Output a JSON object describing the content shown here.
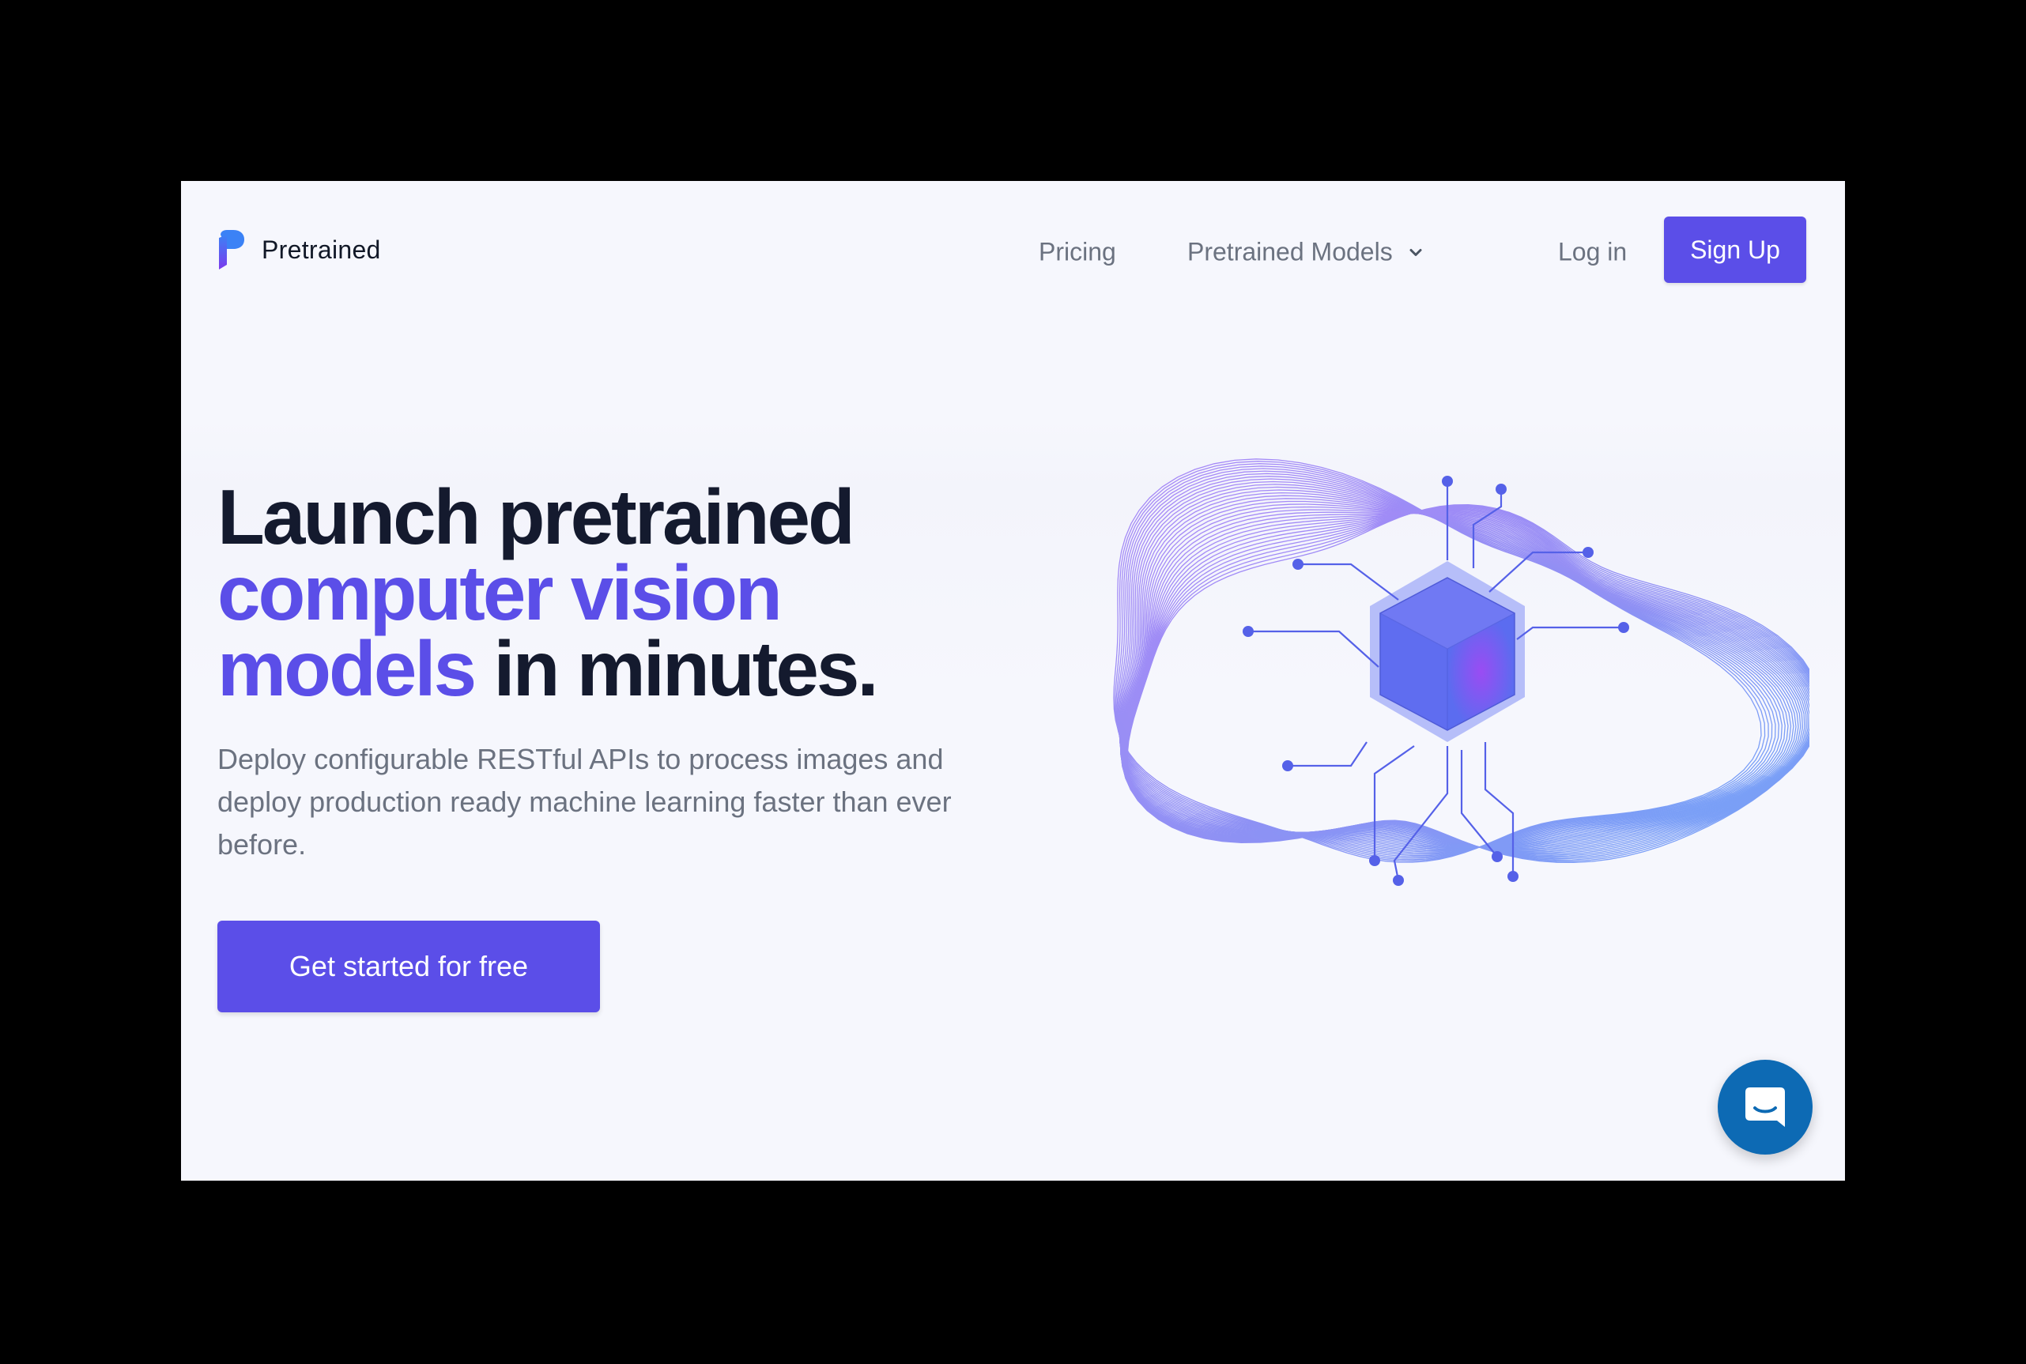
{
  "brand": {
    "name": "Pretrained",
    "logo_icon": "pretrained-logo-icon",
    "primary_color": "#5b4ee8"
  },
  "nav": {
    "pricing": "Pricing",
    "models": "Pretrained Models",
    "models_icon": "chevron-down-icon",
    "login": "Log in",
    "signup": "Sign Up"
  },
  "hero": {
    "headline_part1": "Launch pretrained",
    "headline_accent1": "computer vision",
    "headline_accent2": "models",
    "headline_part2": " in minutes.",
    "subtext": "Deploy configurable RESTful APIs to process images and deploy production ready machine learning faster than ever before.",
    "cta": "Get started for free",
    "illustration_icon": "neural-cube-illustration"
  },
  "chat": {
    "icon": "chat-bubble-icon",
    "color": "#0d6ab4"
  }
}
